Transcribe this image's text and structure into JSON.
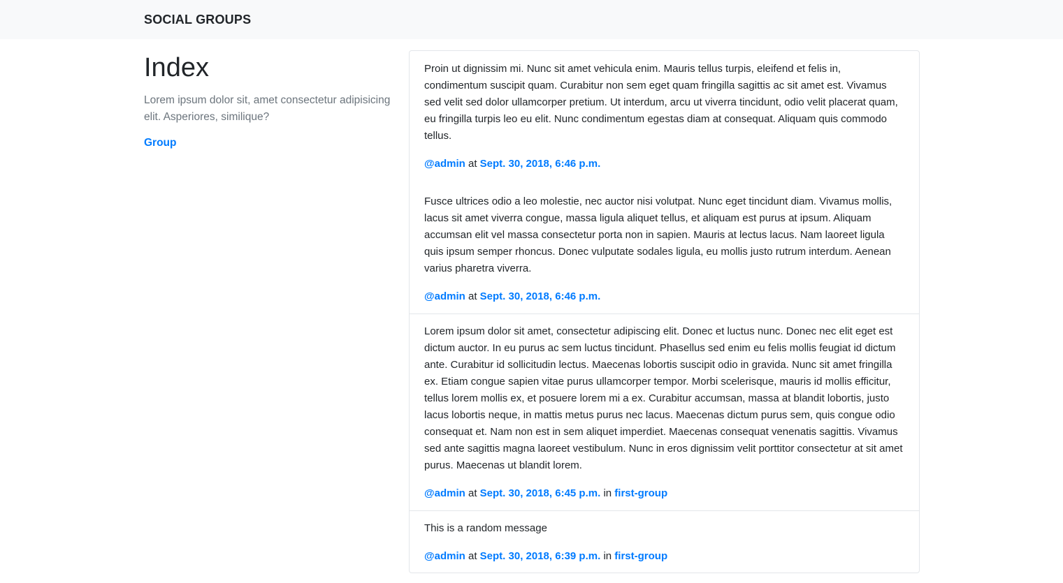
{
  "navbar": {
    "brand": "SOCIAL GROUPS"
  },
  "sidebar": {
    "title": "Index",
    "description": "Lorem ipsum dolor sit, amet consectetur adipisicing elit. Asperiores, similique?",
    "group_link": "Group"
  },
  "meta_words": {
    "at": "at",
    "in": "in"
  },
  "posts": [
    {
      "body": "Proin ut dignissim mi. Nunc sit amet vehicula enim. Mauris tellus turpis, eleifend et felis in, condimentum suscipit quam. Curabitur non sem eget quam fringilla sagittis ac sit amet est. Vivamus sed velit sed dolor ullamcorper pretium. Ut interdum, arcu ut viverra tincidunt, odio velit placerat quam, eu fringilla turpis leo eu elit. Nunc condimentum egestas diam at consequat. Aliquam quis commodo tellus.",
      "user": "@admin",
      "date": "Sept. 30, 2018, 6:46 p.m.",
      "group": ""
    },
    {
      "body": "Fusce ultrices odio a leo molestie, nec auctor nisi volutpat. Nunc eget tincidunt diam. Vivamus mollis, lacus sit amet viverra congue, massa ligula aliquet tellus, et aliquam est purus at ipsum. Aliquam accumsan elit vel massa consectetur porta non in sapien. Mauris at lectus lacus. Nam laoreet ligula quis ipsum semper rhoncus. Donec vulputate sodales ligula, eu mollis justo rutrum interdum. Aenean varius pharetra viverra.",
      "user": "@admin",
      "date": "Sept. 30, 2018, 6:46 p.m.",
      "group": ""
    },
    {
      "body": "Lorem ipsum dolor sit amet, consectetur adipiscing elit. Donec et luctus nunc. Donec nec elit eget est dictum auctor. In eu purus ac sem luctus tincidunt. Phasellus sed enim eu felis mollis feugiat id dictum ante. Curabitur id sollicitudin lectus. Maecenas lobortis suscipit odio in gravida. Nunc sit amet fringilla ex. Etiam congue sapien vitae purus ullamcorper tempor. Morbi scelerisque, mauris id mollis efficitur, tellus lorem mollis ex, et posuere lorem mi a ex. Curabitur accumsan, massa at blandit lobortis, justo lacus lobortis neque, in mattis metus purus nec lacus. Maecenas dictum purus sem, quis congue odio consequat et. Nam non est in sem aliquet imperdiet. Maecenas consequat venenatis sagittis. Vivamus sed ante sagittis magna laoreet vestibulum. Nunc in eros dignissim velit porttitor consectetur at sit amet purus. Maecenas ut blandit lorem.",
      "user": "@admin",
      "date": "Sept. 30, 2018, 6:45 p.m.",
      "group": "first-group"
    },
    {
      "body": "This is a random message",
      "user": "@admin",
      "date": "Sept. 30, 2018, 6:39 p.m.",
      "group": "first-group"
    }
  ]
}
